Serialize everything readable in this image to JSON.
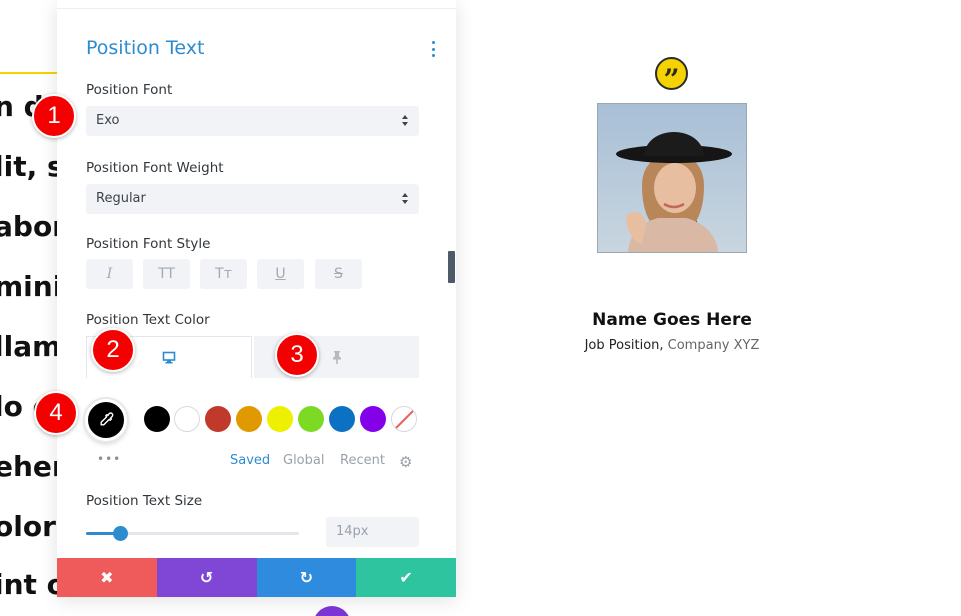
{
  "background_text": [
    "n do",
    "lit, s",
    "abori",
    "minim",
    "llam",
    "lo c",
    "ehen",
    "olore",
    "int o"
  ],
  "panel": {
    "section_title": "Position Text",
    "fields": {
      "font_label": "Position Font",
      "font_value": "Exo",
      "weight_label": "Position Font Weight",
      "weight_value": "Regular",
      "style_label": "Position Font Style",
      "style_buttons": [
        "I",
        "TT",
        "Tт",
        "U",
        "S"
      ],
      "color_label": "Position Text Color",
      "size_label": "Position Text Size",
      "size_value": "14px",
      "size_slider_fraction": 0.16
    },
    "palette_tabs": [
      "Saved",
      "Global",
      "Recent"
    ],
    "swatch_colors": [
      "#000000",
      "#ffffff",
      "#c0392b",
      "#e09900",
      "#edf000",
      "#7cda24",
      "#0c71c3",
      "#8300e9"
    ],
    "accent_color": "#2d8ccf"
  },
  "markers": [
    "1",
    "2",
    "3",
    "4"
  ],
  "actions": {
    "cancel": "✖",
    "undo": "↺",
    "redo": "↻",
    "save": "✔"
  },
  "preview": {
    "name": "Name Goes Here",
    "job_position": "Job Position",
    "separator": ", ",
    "company": "Company XYZ"
  }
}
